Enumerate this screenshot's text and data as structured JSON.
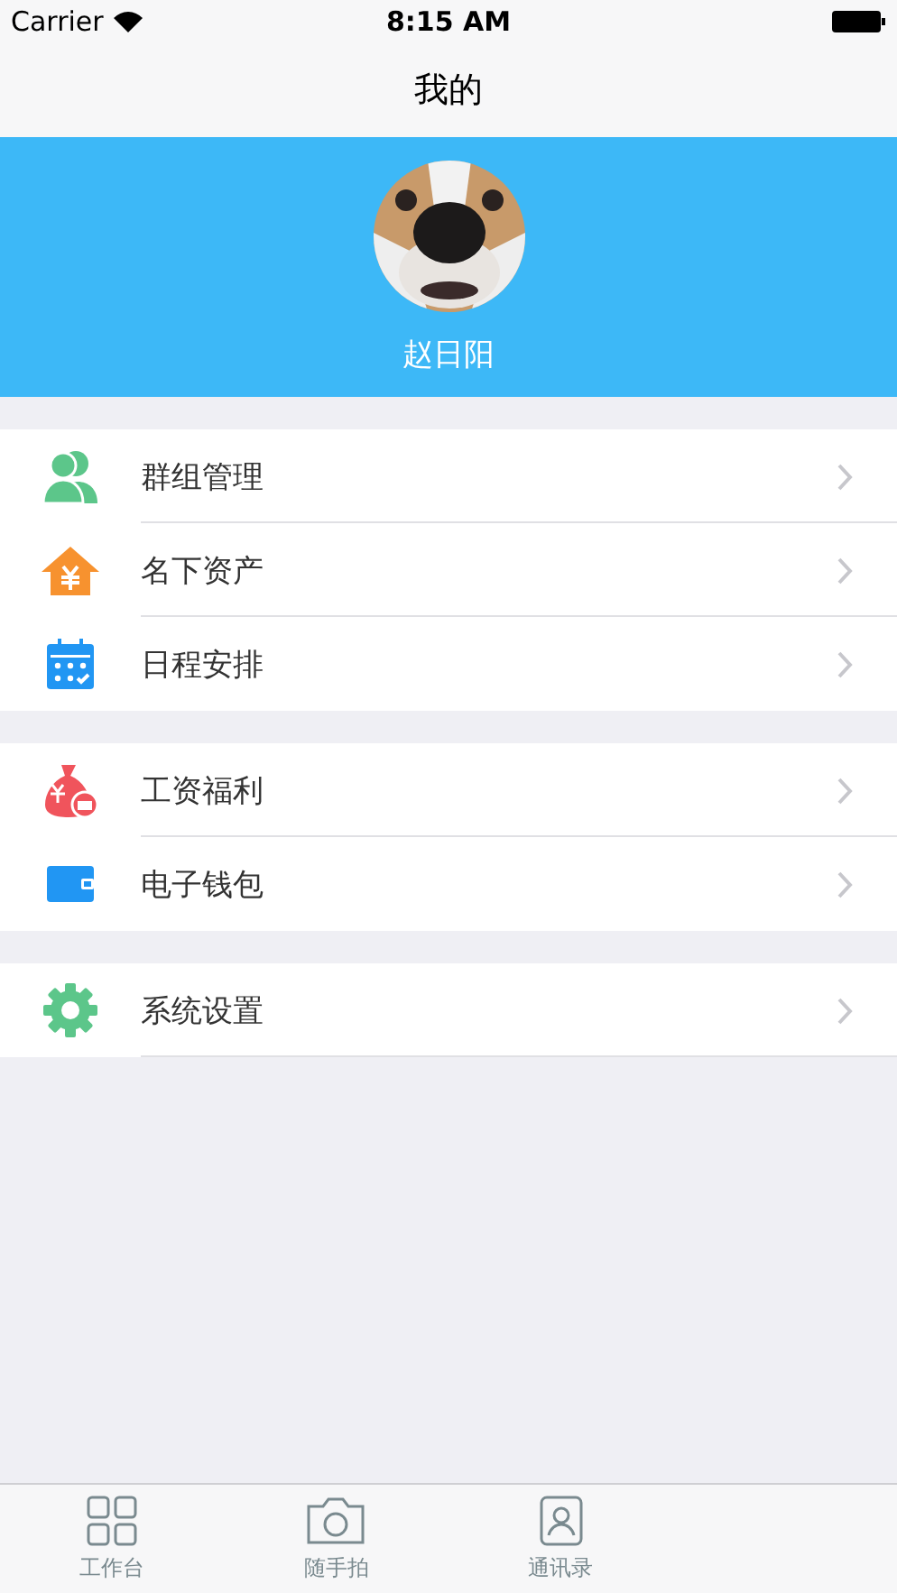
{
  "status_bar": {
    "carrier": "Carrier",
    "time": "8:15 AM"
  },
  "nav": {
    "title": "我的"
  },
  "profile": {
    "name": "赵日阳"
  },
  "groups": [
    {
      "items": [
        {
          "kind": "people",
          "label": "群组管理"
        },
        {
          "kind": "house",
          "label": "名下资产"
        },
        {
          "kind": "calendar",
          "label": "日程安排"
        }
      ]
    },
    {
      "items": [
        {
          "kind": "moneybag",
          "label": "工资福利"
        },
        {
          "kind": "wallet",
          "label": "电子钱包"
        }
      ]
    },
    {
      "items": [
        {
          "kind": "gear",
          "label": "系统设置"
        }
      ]
    }
  ],
  "tab_bar": [
    {
      "kind": "grid",
      "label": "工作台",
      "selected": false
    },
    {
      "kind": "camera",
      "label": "随手拍",
      "selected": false
    },
    {
      "kind": "contacts",
      "label": "通讯录",
      "selected": false
    }
  ]
}
